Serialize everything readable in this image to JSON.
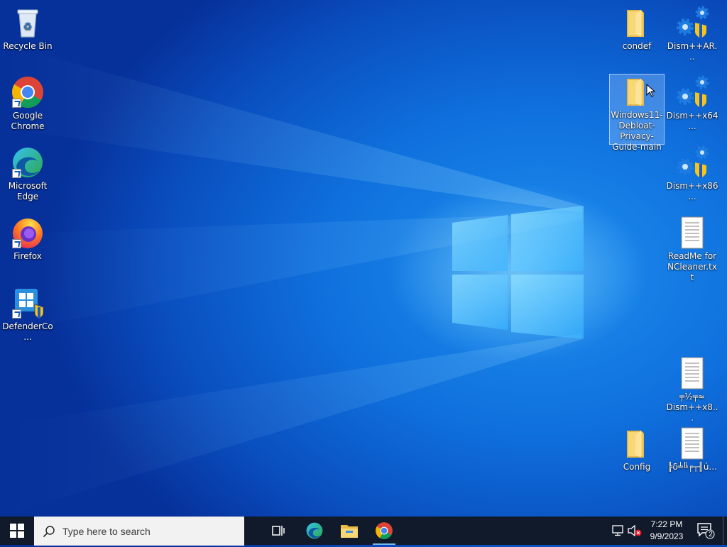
{
  "desktop": {
    "left_icons": [
      {
        "label": "Recycle Bin",
        "icon": "recycle-bin-icon"
      },
      {
        "label": "Google Chrome",
        "icon": "chrome-icon"
      },
      {
        "label": "Microsoft Edge",
        "icon": "edge-icon"
      },
      {
        "label": "Firefox",
        "icon": "firefox-icon"
      },
      {
        "label": "DefenderCo...",
        "icon": "defender-control-icon"
      }
    ],
    "right_icons": [
      {
        "label": "condef",
        "icon": "folder-icon"
      },
      {
        "label": "Dism++AR...",
        "icon": "dism-icon"
      },
      {
        "label": "Windows11-Debloat-Privacy-Guide-main",
        "icon": "folder-icon",
        "selected": true
      },
      {
        "label": "Dism++x64...",
        "icon": "dism-icon"
      },
      {
        "label": "Dism++x86...",
        "icon": "dism-icon"
      },
      {
        "label": "ReadMe for NCleaner.txt",
        "icon": "text-file-icon"
      },
      {
        "label": "╤½╤≈ Dism++x8...",
        "icon": "text-file-icon"
      },
      {
        "label": "Config",
        "icon": "folder-icon"
      },
      {
        "label": "╠δ╧╚╒┬╢ú...",
        "icon": "text-file-icon"
      }
    ]
  },
  "taskbar": {
    "search_placeholder": "Type here to search",
    "pinned": [
      "task-view",
      "edge",
      "file-explorer",
      "chrome"
    ],
    "clock": {
      "time": "7:22 PM",
      "date": "9/9/2023"
    },
    "notifications_count": "2",
    "background_color": "#101a2b"
  },
  "colors": {
    "wallpaper_accent": "#0f6fdc",
    "folder": "#f8d775",
    "selection": "#a0c8ff"
  }
}
